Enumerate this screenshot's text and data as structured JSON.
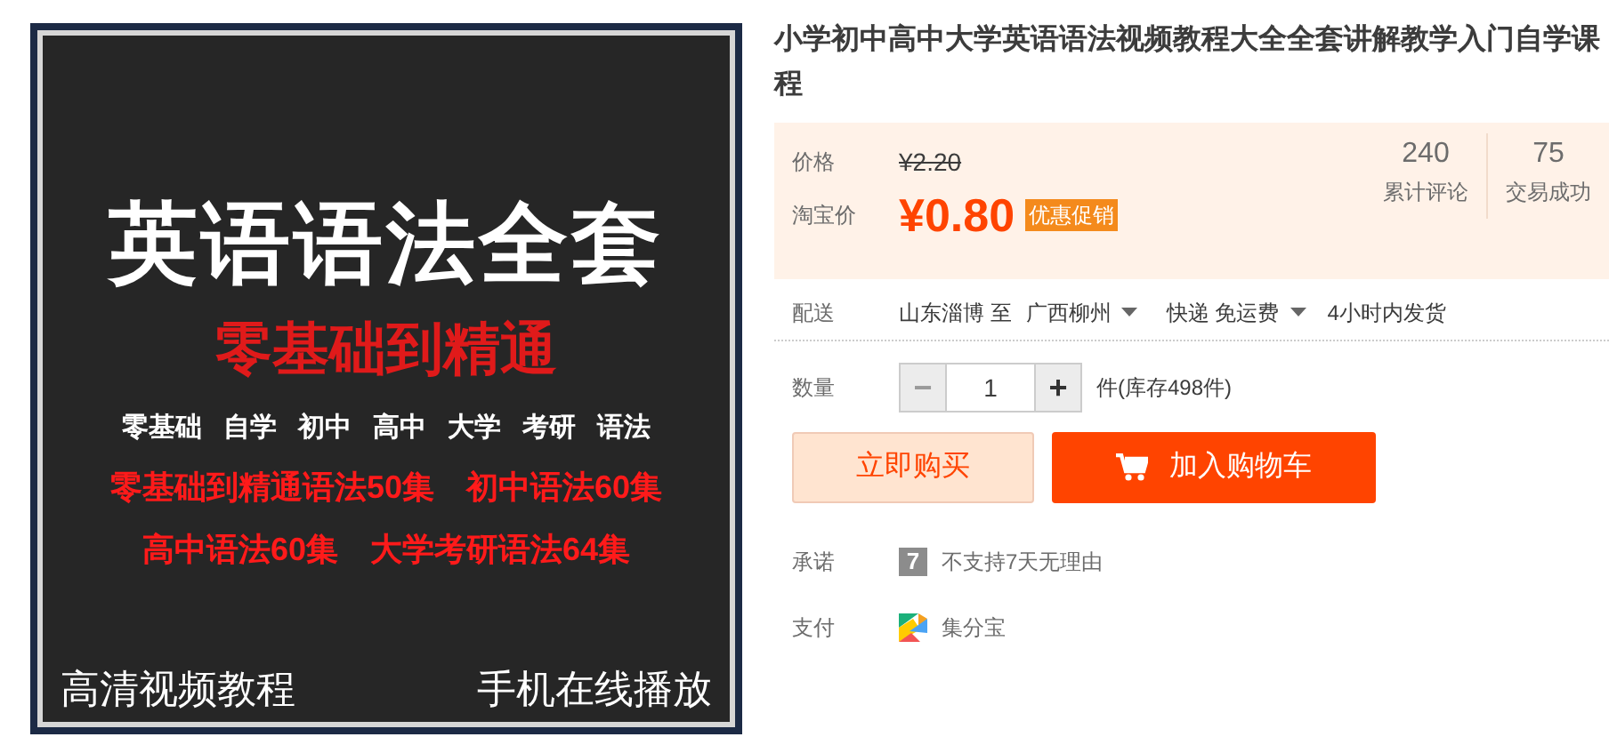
{
  "product_image": {
    "headline": "英语语法全套",
    "subtitle": "零基础到精通",
    "tags": [
      "零基础",
      "自学",
      "初中",
      "高中",
      "大学",
      "考研",
      "语法"
    ],
    "series_lines": [
      [
        "零基础到精通语法50集",
        "初中语法60集"
      ],
      [
        "高中语法60集",
        "大学考研语法64集"
      ]
    ],
    "footer": [
      "高清视频教程",
      "手机在线播放"
    ]
  },
  "title": "小学初中高中大学英语语法视频教程大全全套讲解教学入门自学课程",
  "price_panel": {
    "price_label": "价格",
    "original_price": "¥2.20",
    "promo_label": "淘宝价",
    "currency": "¥",
    "promo_price": "0.80",
    "promo_badge": "优惠促销",
    "stats": [
      {
        "value": "240",
        "label": "累计评论"
      },
      {
        "value": "75",
        "label": "交易成功"
      }
    ]
  },
  "delivery": {
    "label": "配送",
    "from": "山东淄博 至",
    "to": "广西柳州",
    "shipping": "快递 免运费",
    "dispatch": "4小时内发货"
  },
  "quantity": {
    "label": "数量",
    "minus": "−",
    "value": "1",
    "plus": "+",
    "minus_disabled": true,
    "stock": "件(库存498件)"
  },
  "buttons": [
    {
      "kind": "secondary",
      "label": "立即购买"
    },
    {
      "kind": "primary",
      "label": "加入购物车"
    }
  ],
  "services": [
    {
      "kind": "promise",
      "label": "承诺",
      "icon_text": "7",
      "text": "不支持7天无理由"
    },
    {
      "kind": "payment",
      "label": "支付",
      "text": "集分宝"
    }
  ]
}
